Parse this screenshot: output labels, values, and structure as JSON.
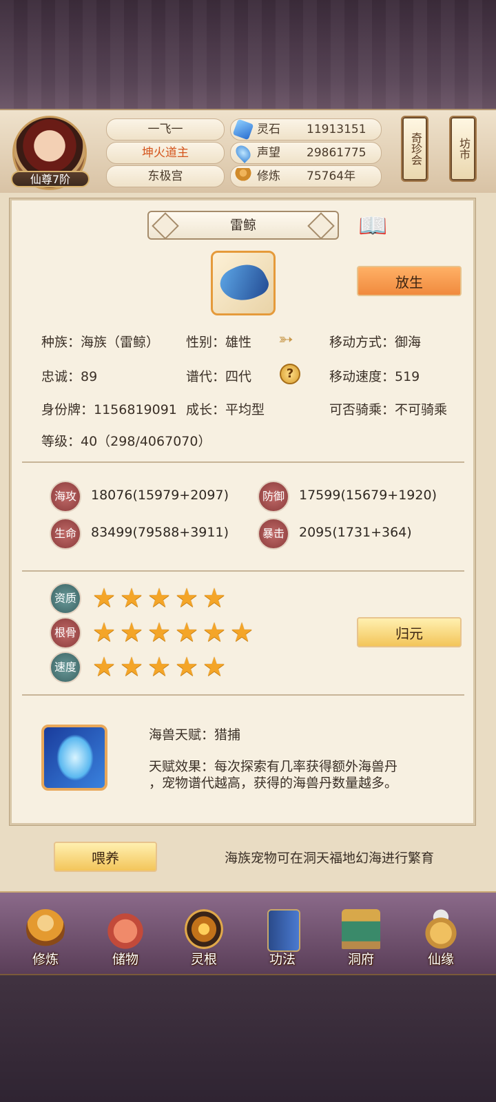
{
  "header": {
    "player_name": "一飞一",
    "title": "坤火道主",
    "sect": "东极宫",
    "rank": "仙尊7阶",
    "resources": [
      {
        "label": "灵石",
        "value": "11913151",
        "icon": "spirit-stone-icon",
        "color": "#3a8ee0"
      },
      {
        "label": "声望",
        "value": "29861775",
        "icon": "reputation-icon",
        "color": "#4aa0e8"
      },
      {
        "label": "修炼",
        "value": "75764年",
        "icon": "meditation-icon",
        "color": "#d89a3a"
      }
    ],
    "scroll_buttons": [
      "奇珍会",
      "坊市"
    ]
  },
  "pet": {
    "name": "雷鲸",
    "release_button": "放生",
    "info": {
      "race": "种族：海族（雷鲸）",
      "gender": "性别：雄性",
      "move_type": "移动方式：御海",
      "loyalty": "忠诚：89",
      "generation": "谱代：四代",
      "move_speed": "移动速度：519",
      "id_tag": "身份牌：1156819091",
      "growth": "成长：平均型",
      "rideable": "可否骑乘：不可骑乘",
      "level": "等级：40（298/4067070）"
    },
    "stats": [
      {
        "badge": "海攻",
        "value": "18076(15979+2097)"
      },
      {
        "badge": "防御",
        "value": "17599(15679+1920)"
      },
      {
        "badge": "生命",
        "value": "83499(79588+3911)"
      },
      {
        "badge": "暴击",
        "value": "2095(1731+364)"
      }
    ],
    "ratings": [
      {
        "badge": "资质",
        "stars": 5
      },
      {
        "badge": "根骨",
        "stars": 6
      },
      {
        "badge": "速度",
        "stars": 5
      }
    ],
    "return_button": "归元",
    "talent": {
      "name": "海兽天赋：猎捕",
      "effect_line1": "天赋效果：每次探索有几率获得额外海兽丹",
      "effect_line2": "，宠物谱代越高，获得的海兽丹数量越多。"
    },
    "feed_button": "喂养",
    "breed_tip": "海族宠物可在洞天福地幻海进行繁育"
  },
  "nav": [
    "修炼",
    "储物",
    "灵根",
    "功法",
    "洞府",
    "仙缘"
  ]
}
